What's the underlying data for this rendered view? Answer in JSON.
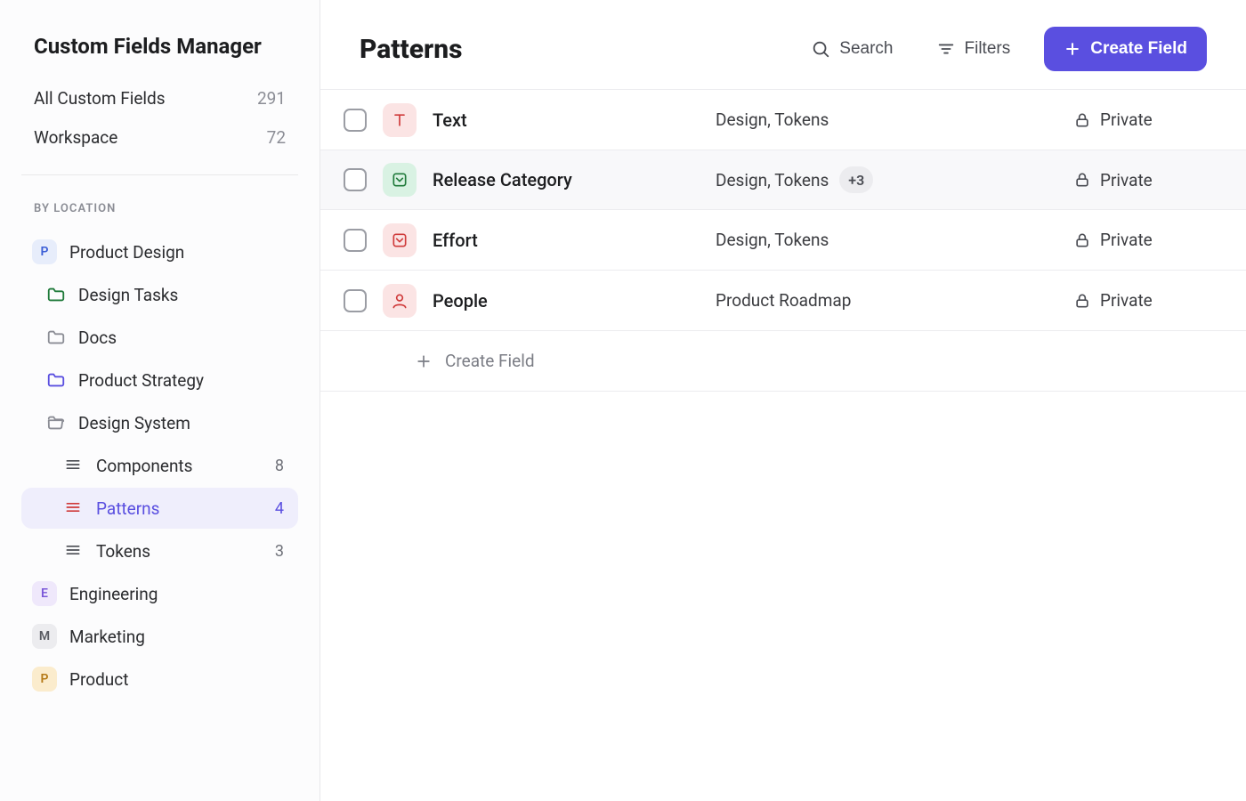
{
  "sidebar": {
    "title": "Custom Fields Manager",
    "nav": [
      {
        "label": "All Custom Fields",
        "count": "291"
      },
      {
        "label": "Workspace",
        "count": "72"
      }
    ],
    "section_label": "BY LOCATION",
    "product_design": {
      "badge": "P",
      "label": "Product Design",
      "children": {
        "design_tasks": "Design Tasks",
        "docs": "Docs",
        "product_strategy": "Product Strategy",
        "design_system": {
          "label": "Design System",
          "components": {
            "label": "Components",
            "count": "8"
          },
          "patterns": {
            "label": "Patterns",
            "count": "4"
          },
          "tokens": {
            "label": "Tokens",
            "count": "3"
          }
        }
      }
    },
    "engineering": {
      "badge": "E",
      "label": "Engineering"
    },
    "marketing": {
      "badge": "M",
      "label": "Marketing"
    },
    "product": {
      "badge": "P",
      "label": "Product"
    }
  },
  "header": {
    "title": "Patterns",
    "search": "Search",
    "filters": "Filters",
    "create": "Create Field"
  },
  "rows": [
    {
      "name": "Text",
      "locations": "Design, Tokens",
      "extra": "",
      "visibility": "Private",
      "icon": "text"
    },
    {
      "name": "Release Category",
      "locations": "Design, Tokens",
      "extra": "+3",
      "visibility": "Private",
      "icon": "select"
    },
    {
      "name": "Effort",
      "locations": "Design, Tokens",
      "extra": "",
      "visibility": "Private",
      "icon": "effort"
    },
    {
      "name": "People",
      "locations": "Product Roadmap",
      "extra": "",
      "visibility": "Private",
      "icon": "people"
    }
  ],
  "create_row": "Create Field"
}
